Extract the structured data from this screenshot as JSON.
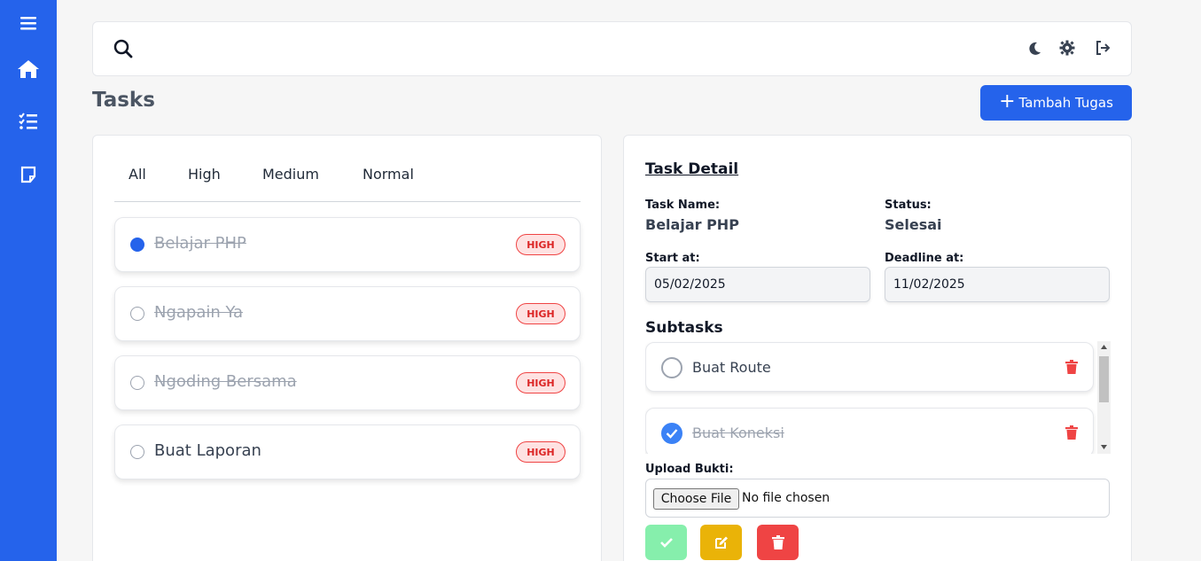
{
  "sidebar": {
    "items": [
      {
        "name": "menu-icon"
      },
      {
        "name": "home-icon"
      },
      {
        "name": "checklist-icon"
      },
      {
        "name": "note-icon"
      }
    ],
    "color": "#2563eb"
  },
  "topbar": {
    "icons": [
      "search-icon",
      "moon-icon",
      "gear-icon",
      "logout-icon"
    ]
  },
  "page": {
    "title": "Tasks",
    "add_button_label": "Tambah Tugas"
  },
  "filters": [
    "All",
    "High",
    "Medium",
    "Normal"
  ],
  "tasks": [
    {
      "name": "Belajar PHP",
      "priority": "HIGH",
      "selected": true,
      "done": true
    },
    {
      "name": "Ngapain Ya",
      "priority": "HIGH",
      "selected": false,
      "done": true
    },
    {
      "name": "Ngoding Bersama",
      "priority": "HIGH",
      "selected": false,
      "done": true
    },
    {
      "name": "Buat Laporan",
      "priority": "HIGH",
      "selected": false,
      "done": false
    }
  ],
  "detail": {
    "title": "Task Detail",
    "task_name_label": "Task Name:",
    "task_name": "Belajar PHP",
    "status_label": "Status:",
    "status": "Selesai",
    "start_label": "Start at:",
    "start_value": "05/02/2025",
    "deadline_label": "Deadline at:",
    "deadline_value": "11/02/2025",
    "subtasks_title": "Subtasks",
    "subtasks": [
      {
        "name": "Buat Route",
        "done": false
      },
      {
        "name": "Buat Koneksi",
        "done": true
      }
    ],
    "upload_label": "Upload Bukti:",
    "file_button": "Choose File",
    "file_status": "No file chosen"
  },
  "colors": {
    "accent": "#2563eb",
    "danger": "#ef4444",
    "success_light": "#86efac",
    "warning": "#eab308"
  }
}
